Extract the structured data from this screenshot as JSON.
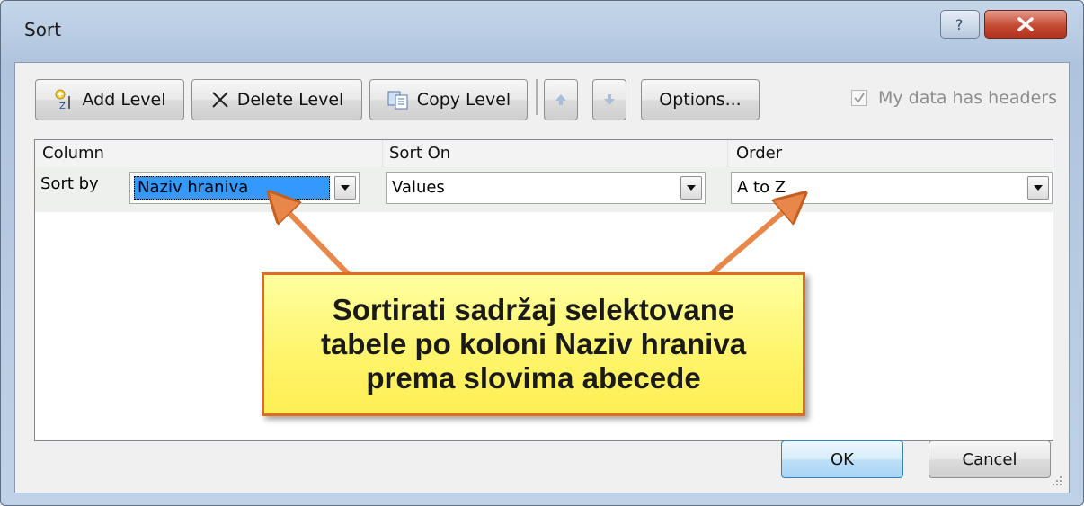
{
  "window": {
    "title": "Sort"
  },
  "toolbar": {
    "add_level": "Add Level",
    "delete_level": "Delete Level",
    "copy_level": "Copy Level",
    "options": "Options...",
    "headers_checkbox": "My data has headers",
    "headers_checked": true
  },
  "grid": {
    "headers": {
      "column": "Column",
      "sort_on": "Sort On",
      "order": "Order"
    },
    "rows": [
      {
        "label": "Sort by",
        "column": "Naziv hraniva",
        "sort_on": "Values",
        "order": "A to Z"
      }
    ]
  },
  "callout": {
    "lines": [
      "Sortirati sadržaj selektovane",
      "tabele po koloni Naziv hraniva",
      "prema slovima abecede"
    ]
  },
  "footer": {
    "ok": "OK",
    "cancel": "Cancel"
  },
  "colors": {
    "callout_fill": "#fff46a",
    "callout_border": "#e06c1e",
    "selection": "#3399ff"
  }
}
